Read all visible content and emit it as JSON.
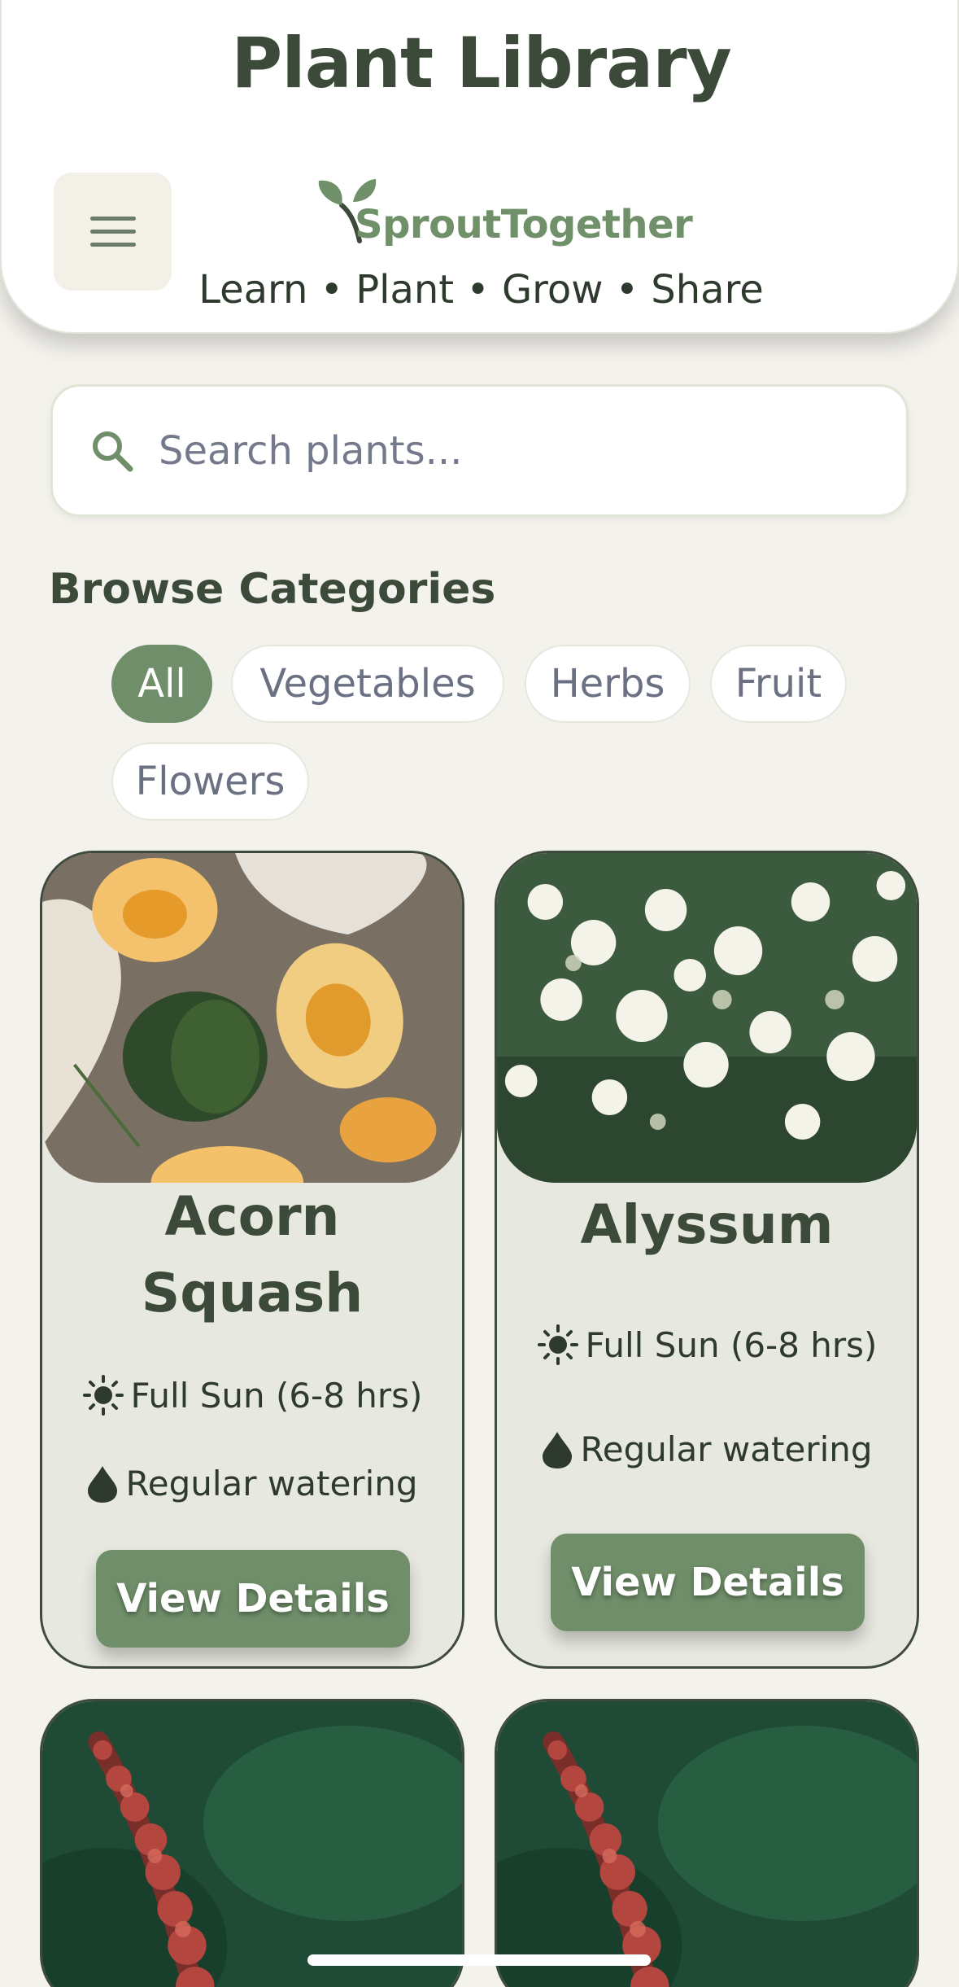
{
  "header": {
    "title": "Plant Library",
    "logo_text": "SproutTogether",
    "tagline": "Learn • Plant • Grow • Share",
    "menu_icon": "hamburger-menu-icon"
  },
  "search": {
    "placeholder": "Search plants...",
    "icon": "search-icon"
  },
  "categories": {
    "title": "Browse Categories",
    "chips": [
      {
        "label": "All",
        "active": true
      },
      {
        "label": "Vegetables",
        "active": false
      },
      {
        "label": "Herbs",
        "active": false
      },
      {
        "label": "Fruit",
        "active": false
      },
      {
        "label": "Flowers",
        "active": false
      }
    ]
  },
  "plants": [
    {
      "name_line1": "Acorn",
      "name_line2": "Squash",
      "sun": "Full Sun (6-8 hrs)",
      "water": "Regular watering",
      "button": "View Details"
    },
    {
      "name_line1": "Alyssum",
      "sun": "Full Sun (6-8 hrs)",
      "water": "Regular watering",
      "button": "View Details"
    }
  ],
  "colors": {
    "accent": "#6f8e69",
    "background": "#f4f2ec",
    "card": "#e7e8e0",
    "text": "#3c4a3a"
  }
}
